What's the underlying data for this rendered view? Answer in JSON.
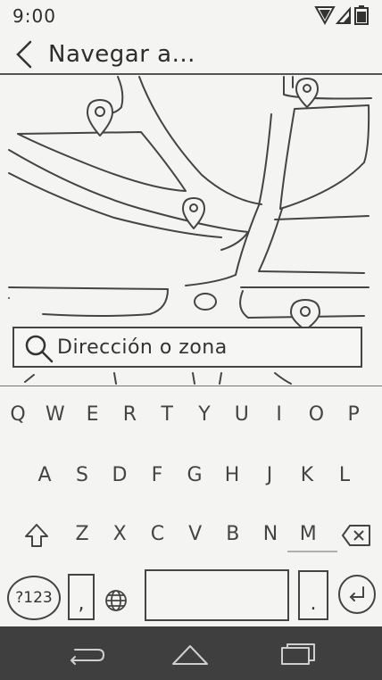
{
  "status_bar": {
    "time": "9:00",
    "icons": [
      "wifi-icon",
      "signal-icon",
      "battery-icon"
    ]
  },
  "app_bar": {
    "back_icon": "back-arrow-icon",
    "title": "Navegar a..."
  },
  "map": {
    "pins": [
      "map-pin-icon",
      "map-pin-icon",
      "map-pin-icon",
      "map-pin-icon"
    ],
    "current_location_icon": "location-circle-icon"
  },
  "search": {
    "icon": "search-icon",
    "placeholder": "Dirección o zona"
  },
  "keyboard": {
    "row1": [
      "Q",
      "W",
      "E",
      "R",
      "T",
      "Y",
      "U",
      "I",
      "O",
      "P"
    ],
    "row2": [
      "A",
      "S",
      "D",
      "F",
      "G",
      "H",
      "J",
      "K",
      "L"
    ],
    "row3": [
      "Z",
      "X",
      "C",
      "V",
      "B",
      "N",
      "M"
    ],
    "shift_icon": "shift-arrow-icon",
    "backspace_icon": "backspace-icon",
    "symbols_label": "?123",
    "comma_label": ",",
    "globe_icon": "globe-icon",
    "period_label": ".",
    "enter_icon": "enter-icon"
  },
  "nav_bar": {
    "icons": [
      "nav-back-icon",
      "nav-home-icon",
      "nav-recents-icon"
    ]
  }
}
